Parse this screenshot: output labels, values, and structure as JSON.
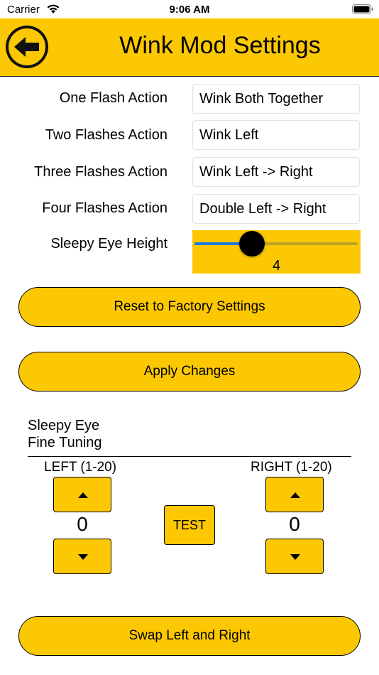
{
  "status_bar": {
    "carrier": "Carrier",
    "time": "9:06 AM"
  },
  "header": {
    "title": "Wink Mod Settings",
    "back_icon": "back-arrow-icon",
    "color": "#fcc803"
  },
  "settings": [
    {
      "label": "One Flash Action",
      "value": "Wink Both Together"
    },
    {
      "label": "Two Flashes Action",
      "value": "Wink Left"
    },
    {
      "label": "Three Flashes Action",
      "value": "Wink Left -> Right"
    },
    {
      "label": "Four Flashes Action",
      "value": "Double Left -> Right"
    }
  ],
  "sleepy_eye": {
    "label": "Sleepy Eye Height",
    "value": "4",
    "slider_fraction": 0.35
  },
  "buttons": {
    "reset": "Reset to Factory Settings",
    "apply": "Apply Changes",
    "swap": "Swap Left and Right",
    "test": "TEST"
  },
  "fine_tuning": {
    "title_line1": "Sleepy Eye",
    "title_line2": "Fine Tuning",
    "left_label": "LEFT (1-20)",
    "right_label": "RIGHT (1-20)",
    "left_value": "0",
    "right_value": "0"
  }
}
